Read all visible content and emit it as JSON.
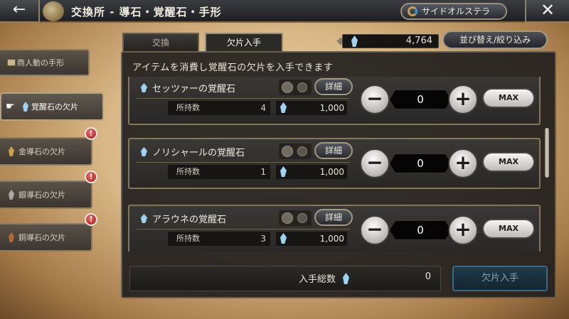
{
  "header": {
    "back_label": "←",
    "title": "交換所 - 導石・覚醒石・手形",
    "character_button": "サイドオルステラ",
    "close_label": "✕"
  },
  "tabs": [
    {
      "label": "交換"
    },
    {
      "label": "欠片入手"
    }
  ],
  "currency": {
    "amount": "4,764"
  },
  "sort_filter_label": "並び替え/絞り込み",
  "info_text": "アイテムを消費し覚醒石の欠片を入手できます",
  "sidebar": {
    "items": [
      {
        "label": "商人動の手形"
      },
      {
        "label": "覚醒石の欠片"
      },
      {
        "label": "金導石の欠片",
        "badge": "!"
      },
      {
        "label": "銀導石の欠片",
        "badge": "!"
      },
      {
        "label": "銅導石の欠片",
        "badge": "!"
      }
    ]
  },
  "items": [
    {
      "name": "セッツァーの覚醒石",
      "detail_label": "詳細",
      "owned_label": "所持数",
      "owned": "4",
      "cost": "1,000",
      "quantity": "0",
      "max_label": "MAX",
      "minus": "−",
      "plus": "+"
    },
    {
      "name": "ノリシャールの覚醒石",
      "detail_label": "詳細",
      "owned_label": "所持数",
      "owned": "1",
      "cost": "1,000",
      "quantity": "0",
      "max_label": "MAX",
      "minus": "−",
      "plus": "+"
    },
    {
      "name": "アラウネの覚醒石",
      "detail_label": "詳細",
      "owned_label": "所持数",
      "owned": "3",
      "cost": "1,000",
      "quantity": "0",
      "max_label": "MAX",
      "minus": "−",
      "plus": "+"
    }
  ],
  "footer": {
    "total_label": "入手総数",
    "total_value": "0",
    "get_button": "欠片入手"
  },
  "colors": {
    "shard_blue": "#9fd2f0",
    "gold_shard": "#c9a24a",
    "silver_shard": "#a9a9a9",
    "copper_shard": "#b06a3a",
    "badge_red": "#c41a1a"
  }
}
